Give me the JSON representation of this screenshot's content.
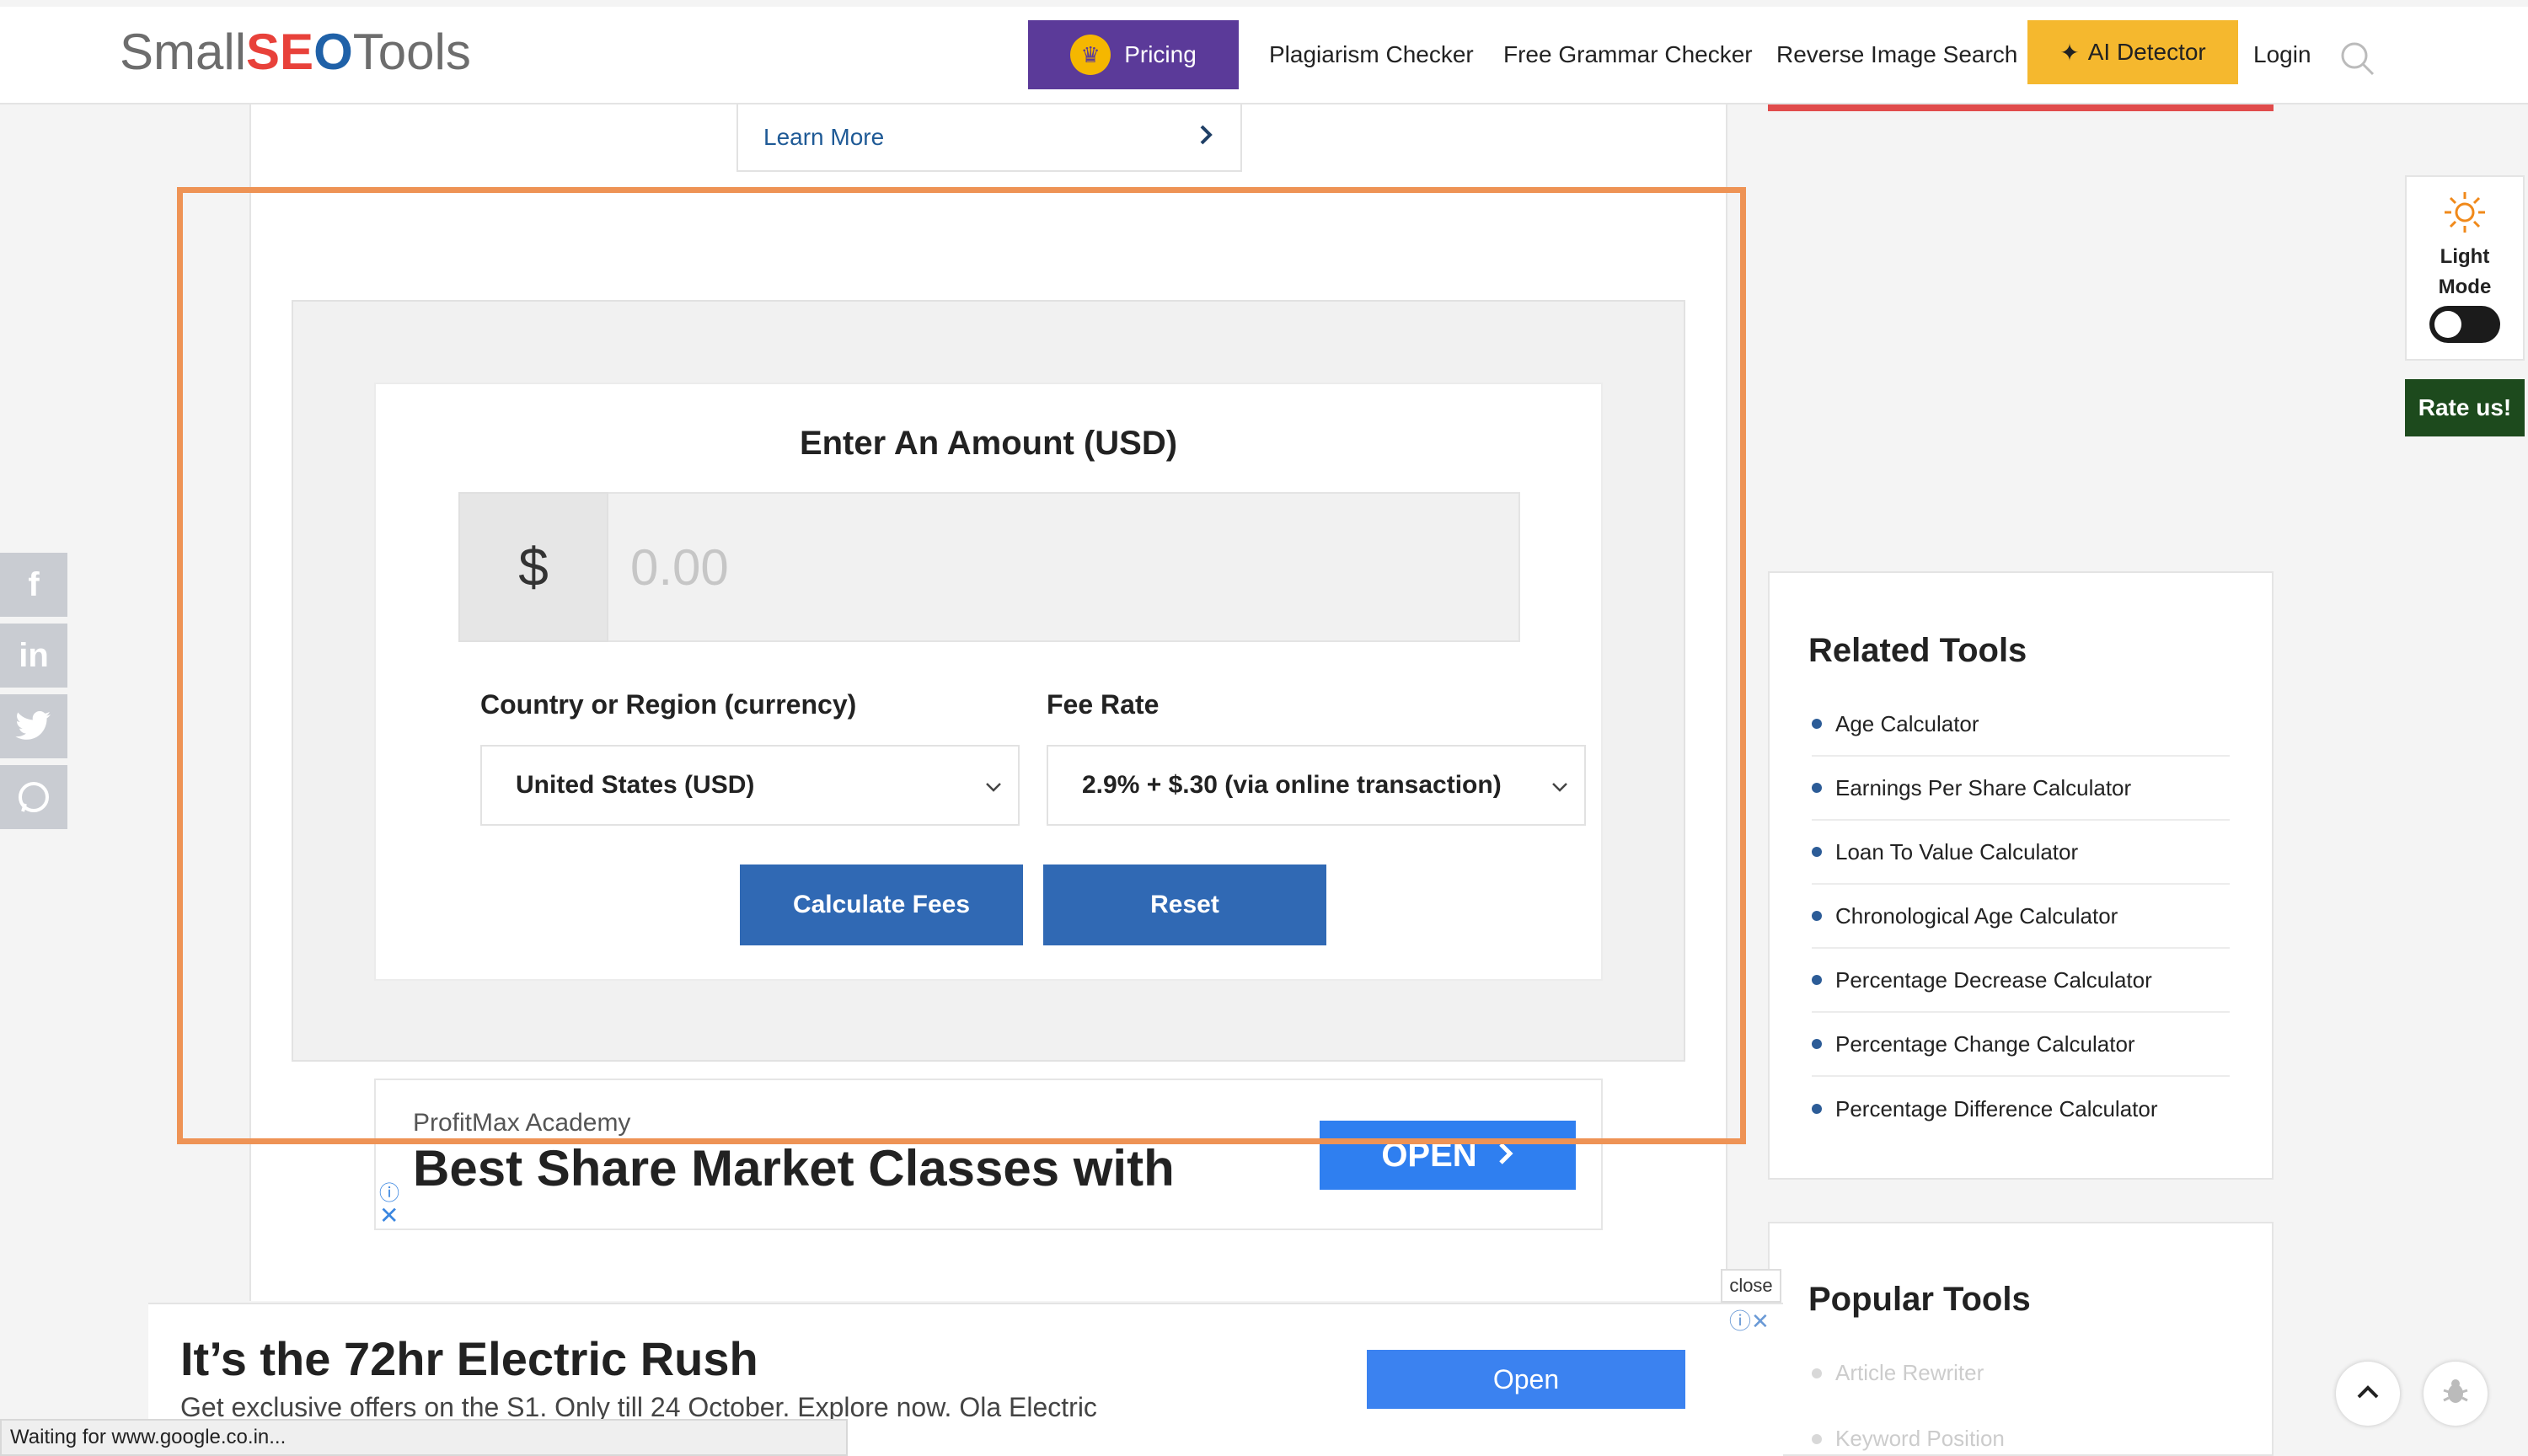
{
  "header": {
    "logo": {
      "part1": "Small",
      "part2": "SE",
      "part3": "O",
      "part4": "Tools"
    },
    "pricing_label": "Pricing",
    "nav": [
      "Plagiarism Checker",
      "Free Grammar Checker",
      "Reverse Image Search"
    ],
    "ai_detector_label": "AI Detector",
    "login_label": "Login"
  },
  "main": {
    "learn_more": "Learn More",
    "form": {
      "title": "Enter An Amount (USD)",
      "currency_symbol": "$",
      "amount_placeholder": "0.00",
      "country_label": "Country or Region (currency)",
      "country_value": "United States (USD)",
      "fee_label": "Fee Rate",
      "fee_value": "2.9% + $.30 (via online transaction)",
      "calculate_label": "Calculate Fees",
      "reset_label": "Reset"
    },
    "ad": {
      "brand": "ProfitMax Academy",
      "headline": "Best Share Market Classes with",
      "open_label": "OPEN"
    }
  },
  "sidebar": {
    "theme": {
      "label_line1": "Light",
      "label_line2": "Mode"
    },
    "rate_label": "Rate us!",
    "related": {
      "title": "Related Tools",
      "items": [
        "Age Calculator",
        "Earnings Per Share Calculator",
        "Loan To Value Calculator",
        "Chronological Age Calculator",
        "Percentage Decrease Calculator",
        "Percentage Change Calculator",
        "Percentage Difference Calculator"
      ]
    },
    "popular": {
      "title": "Popular Tools",
      "items": [
        "Article Rewriter",
        "Keyword Position"
      ]
    }
  },
  "bottom_ad": {
    "headline": "It’s the 72hr Electric Rush",
    "subtext": "Get exclusive offers on the S1. Only till 24 October. Explore now. Ola Electric",
    "open_label": "Open",
    "close_label": "close"
  },
  "status_bar": "Waiting for www.google.co.in...",
  "colors": {
    "accent_blue": "#3069b4",
    "pricing_purple": "#5b3a99",
    "ai_yellow": "#f5b82e",
    "highlight": "#ee9355"
  }
}
